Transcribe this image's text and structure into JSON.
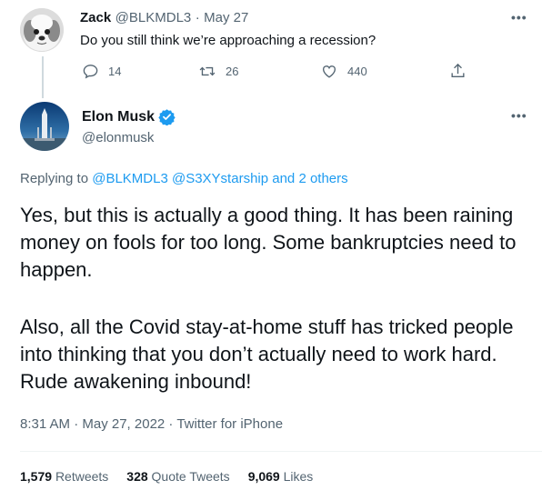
{
  "parent_tweet": {
    "name": "Zack",
    "handle": "@BLKMDL3",
    "separator": "·",
    "date": "May 27",
    "text": "Do you still think we’re approaching a recession?",
    "replies": "14",
    "retweets": "26",
    "likes": "440",
    "more": "•••"
  },
  "main_tweet": {
    "name": "Elon Musk",
    "handle": "@elonmusk",
    "more": "•••",
    "replying_prefix": "Replying to",
    "replying_to": "@BLKMDL3 @S3XYstarship and 2 others",
    "paragraph1": "Yes, but this is actually a good thing. It has been raining money on fools for too long. Some bankruptcies need to happen.",
    "paragraph2": "Also, all the Covid stay-at-home stuff has tricked people into thinking that you don’t actually need to work hard. Rude awakening inbound!",
    "timestamp": "8:31 AM · May 27, 2022 · Twitter for iPhone",
    "stats": {
      "retweets_count": "1,579",
      "retweets_label": "Retweets",
      "quotes_count": "328",
      "quotes_label": "Quote Tweets",
      "likes_count": "9,069",
      "likes_label": "Likes"
    }
  },
  "colors": {
    "accent": "#1d9bf0",
    "verified": "#1d9bf0",
    "text": "#0f1419",
    "muted": "#536471"
  },
  "icons": [
    "reply-icon",
    "retweet-icon",
    "like-icon",
    "share-icon",
    "verified-badge-icon",
    "more-icon"
  ]
}
